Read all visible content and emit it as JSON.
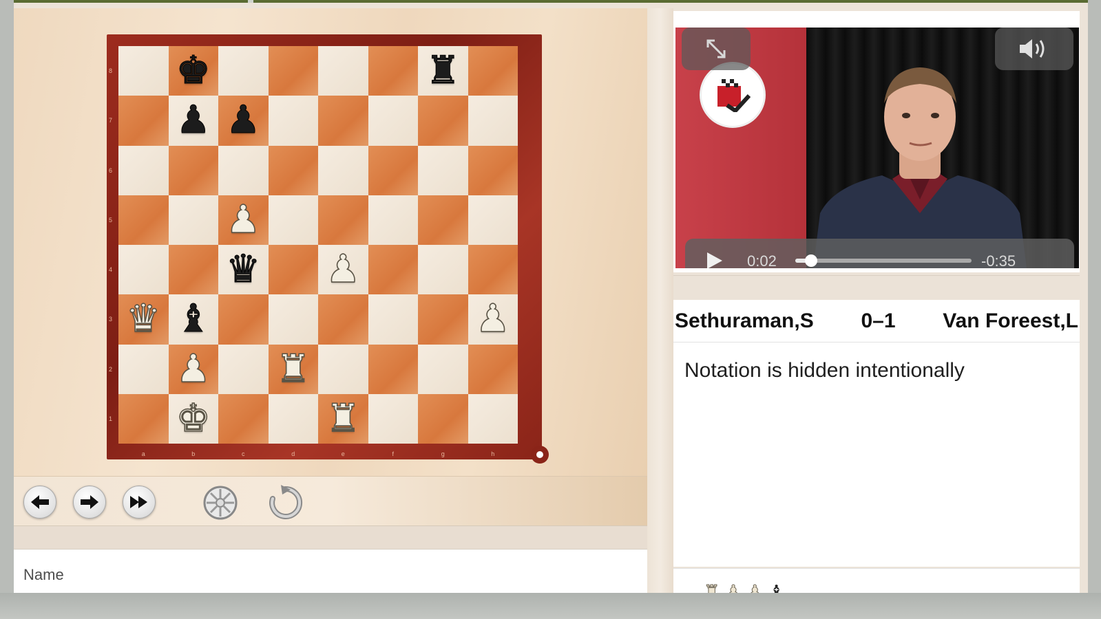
{
  "board": {
    "files": [
      "a",
      "b",
      "c",
      "d",
      "e",
      "f",
      "g",
      "h"
    ],
    "ranks": [
      "8",
      "7",
      "6",
      "5",
      "4",
      "3",
      "2",
      "1"
    ],
    "position": [
      [
        "",
        "bK",
        "",
        "",
        "",
        "",
        "bR",
        ""
      ],
      [
        "",
        "bP",
        "bP",
        "",
        "",
        "",
        "",
        ""
      ],
      [
        "",
        "",
        "",
        "",
        "",
        "",
        "",
        ""
      ],
      [
        "",
        "",
        "wP",
        "",
        "",
        "",
        "",
        ""
      ],
      [
        "",
        "",
        "bQ",
        "",
        "wP",
        "",
        "",
        ""
      ],
      [
        "wQ",
        "bB",
        "",
        "",
        "",
        "",
        "",
        "wP"
      ],
      [
        "",
        "wP",
        "",
        "wR",
        "",
        "",
        "",
        ""
      ],
      [
        "",
        "wK",
        "",
        "",
        "wR",
        "",
        "",
        ""
      ]
    ]
  },
  "controls": {
    "back_icon": "arrow-left-icon",
    "forward_icon": "arrow-right-icon",
    "fast_forward_icon": "fast-forward-icon",
    "wheel_icon": "wheel-icon",
    "undo_icon": "undo-icon"
  },
  "name_field": {
    "placeholder": "Name"
  },
  "video": {
    "elapsed": "0:02",
    "remaining": "-0:35",
    "progress": 0.09
  },
  "game": {
    "white": "Sethuraman,S",
    "result": "0–1",
    "black": "Van Foreest,L"
  },
  "notation_message": "Notation is hidden intentionally",
  "captured": [
    "wR",
    "wP",
    "wP",
    "bB"
  ],
  "colors": {
    "board_frame": "#8a2418",
    "dark_square": "#d8783d",
    "light_square": "#f0e6d8",
    "video_red": "#c8414a"
  }
}
